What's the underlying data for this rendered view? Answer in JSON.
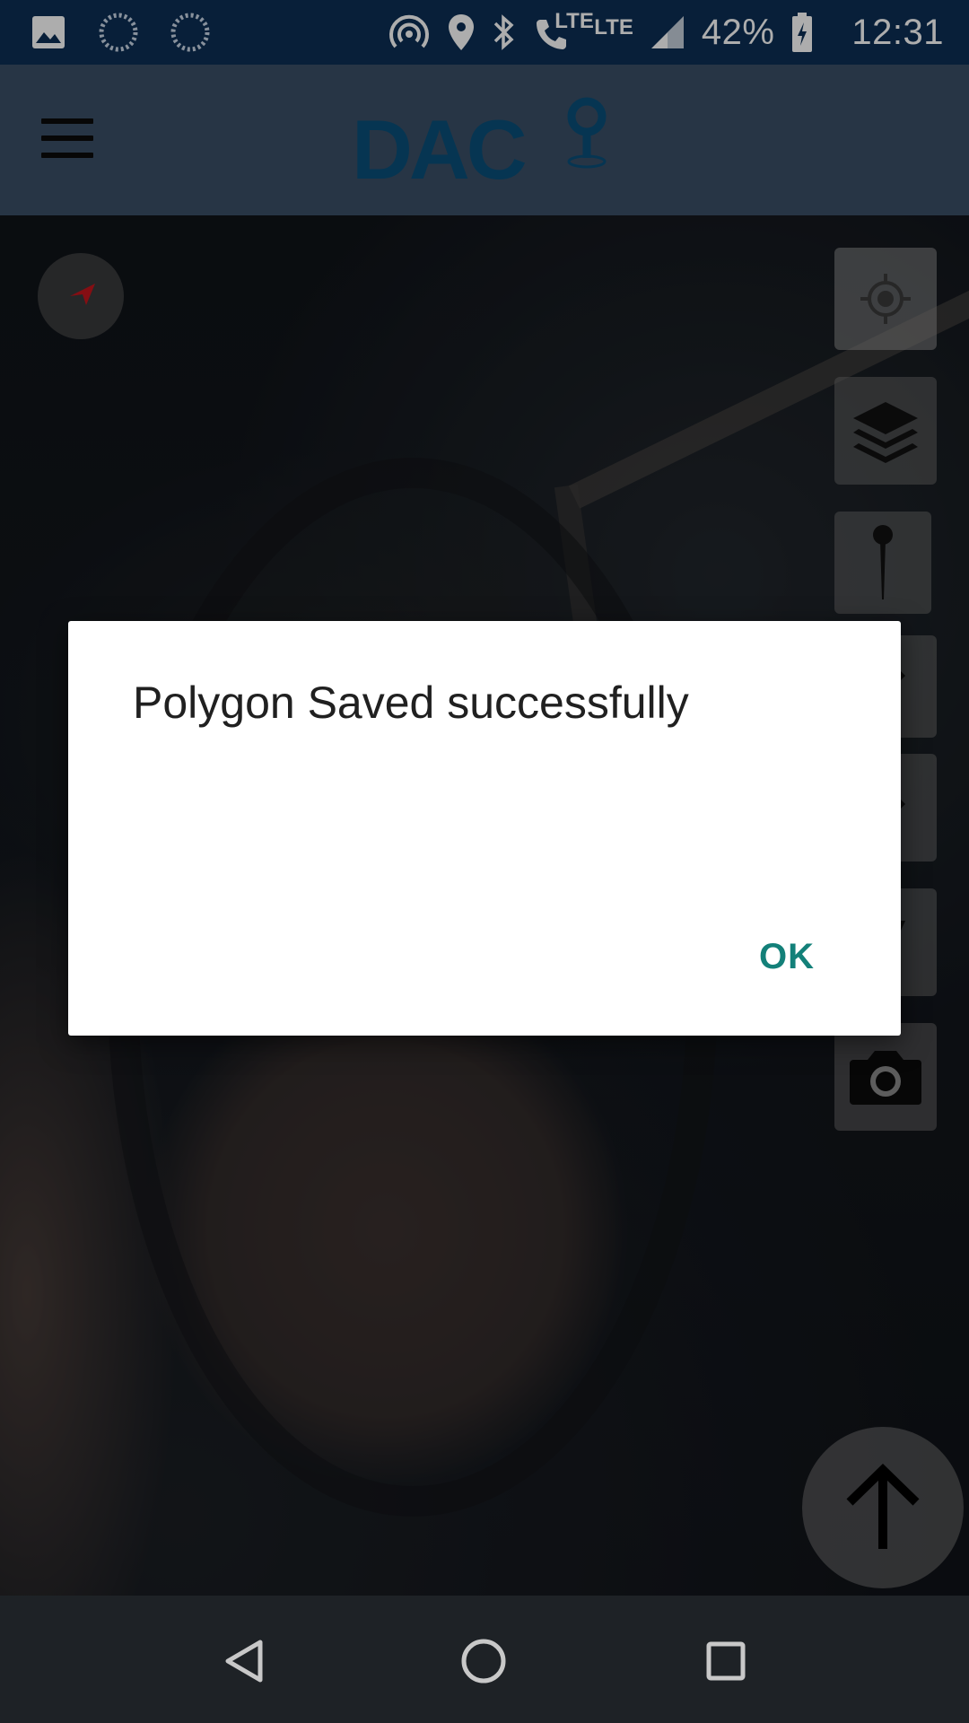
{
  "status_bar": {
    "battery_percent": "42%",
    "time": "12:31",
    "lte_label_1": "LTE",
    "lte_label_2": "LTE",
    "icons": [
      "gallery-icon",
      "sync-icon",
      "sync-icon",
      "hotspot-icon",
      "location-icon",
      "bluetooth-icon",
      "volte-call-icon",
      "signal-icon",
      "battery-charging-icon"
    ]
  },
  "app_bar": {
    "logo_text": "DAC",
    "menu_icon": "hamburger-menu-icon"
  },
  "map": {
    "compass_icon": "compass-icon",
    "tools": [
      "my-location-icon",
      "layers-icon",
      "pin-icon",
      "pencil-icon",
      "eraser-icon",
      "ruler-icon",
      "camera-icon"
    ],
    "fab_icon": "arrow-up-icon"
  },
  "dialog": {
    "message": "Polygon Saved successfully",
    "ok_label": "OK"
  },
  "nav_bar": {
    "icons": [
      "back-icon",
      "home-icon",
      "recents-icon"
    ]
  },
  "colors": {
    "status_bar": "#0c2f55",
    "app_bar": "#3a4f66",
    "logo": "#0a4f7a",
    "dialog_accent": "#138079",
    "nav_bar": "#1e2226"
  }
}
